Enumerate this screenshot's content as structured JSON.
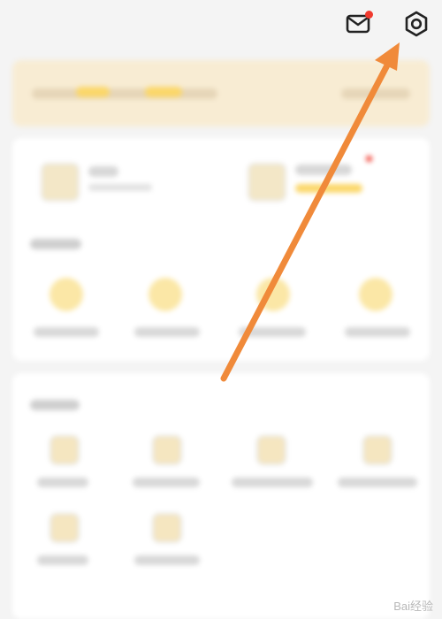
{
  "colors": {
    "accent": "#f6c94b",
    "accent_light": "#fbe7a6",
    "banner_bg": "#f8ecd3",
    "badge": "#f03a2e",
    "arrow": "#f08a3a",
    "card": "#ffffff",
    "page_bg": "#f4f4f4"
  },
  "header": {
    "mail_icon": "envelope-icon",
    "settings_icon": "gear-icon"
  },
  "watermark": {
    "text": "Bai经验"
  }
}
